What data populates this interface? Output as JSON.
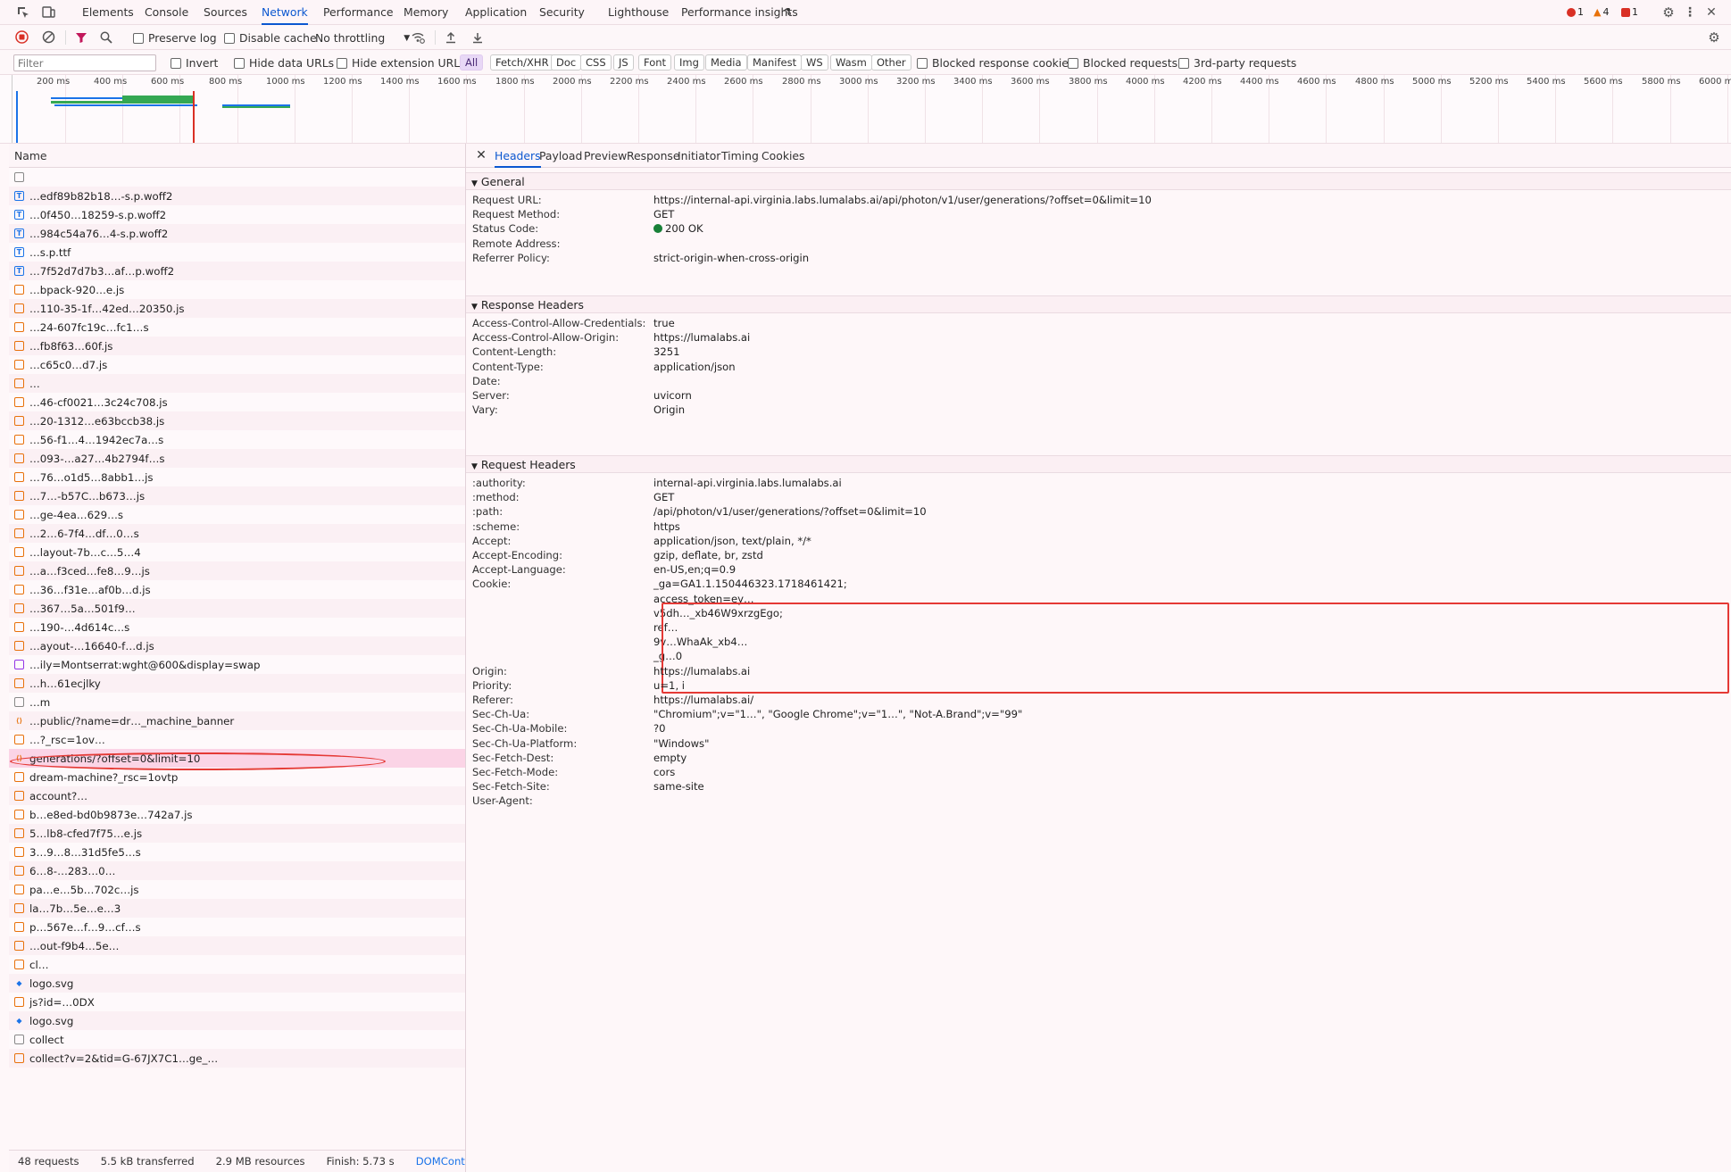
{
  "devtools_tabs": [
    "Elements",
    "Console",
    "Sources",
    "Network",
    "Performance",
    "Memory",
    "Application",
    "Security",
    "Lighthouse",
    "Performance insights"
  ],
  "active_tab": "Network",
  "badges": {
    "errors": "1",
    "warnings": "4",
    "issues": "1"
  },
  "toolbar": {
    "preserve_log": "Preserve log",
    "disable_cache": "Disable cache",
    "throttling": "No throttling"
  },
  "filterbar": {
    "filter_placeholder": "Filter",
    "invert": "Invert",
    "hide_data_urls": "Hide data URLs",
    "hide_extension_urls": "Hide extension URLs",
    "type_filters": [
      "All",
      "Fetch/XHR",
      "Doc",
      "CSS",
      "JS",
      "Font",
      "Img",
      "Media",
      "Manifest",
      "WS",
      "Wasm",
      "Other"
    ],
    "blocked_response_cookies": "Blocked response cookies",
    "blocked_requests": "Blocked requests",
    "third_party": "3rd-party requests"
  },
  "timeline_ticks": [
    "200 ms",
    "400 ms",
    "600 ms",
    "800 ms",
    "1000 ms",
    "1200 ms",
    "1400 ms",
    "1600 ms",
    "1800 ms",
    "2000 ms",
    "2200 ms",
    "2400 ms",
    "2600 ms",
    "2800 ms",
    "3000 ms",
    "3200 ms",
    "3400 ms",
    "3600 ms",
    "3800 ms",
    "4000 ms",
    "4200 ms",
    "4400 ms",
    "4600 ms",
    "4800 ms",
    "5000 ms",
    "5200 ms",
    "5400 ms",
    "5600 ms",
    "5800 ms",
    "6000 ms"
  ],
  "list_header": "Name",
  "requests": [
    {
      "type": "doc",
      "name": ""
    },
    {
      "type": "font",
      "name": "…edf89b82b18…-s.p.woff2"
    },
    {
      "type": "font",
      "name": "…0f450…18259-s.p.woff2"
    },
    {
      "type": "font",
      "name": "…984c54a76…4-s.p.woff2"
    },
    {
      "type": "font",
      "name": "…s.p.ttf"
    },
    {
      "type": "font",
      "name": "…7f52d7d7b3…af…p.woff2"
    },
    {
      "type": "script",
      "name": "…bpack-920…e.js"
    },
    {
      "type": "script",
      "name": "…110-35-1f…42ed…20350.js"
    },
    {
      "type": "script",
      "name": "…24-607fc19c…fc1…s"
    },
    {
      "type": "script",
      "name": "…fb8f63…60f.js"
    },
    {
      "type": "script",
      "name": "…c65c0…d7.js"
    },
    {
      "type": "script",
      "name": "…"
    },
    {
      "type": "script",
      "name": "…46-cf0021…3c24c708.js"
    },
    {
      "type": "script",
      "name": "…20-1312…e63bccb38.js"
    },
    {
      "type": "script",
      "name": "…56-f1…4…1942ec7a…s"
    },
    {
      "type": "script",
      "name": "…093-…a27…4b2794f…s"
    },
    {
      "type": "script",
      "name": "…76…o1d5…8abb1…js"
    },
    {
      "type": "script",
      "name": "…7…-b57C…b673…js"
    },
    {
      "type": "script",
      "name": "…ge-4ea…629…s"
    },
    {
      "type": "script",
      "name": "…2…6-7f4…df…0…s"
    },
    {
      "type": "script",
      "name": "…layout-7b…c…5…4"
    },
    {
      "type": "script",
      "name": "…a…f3ced…fe8…9…js"
    },
    {
      "type": "script",
      "name": "…36…f31e…af0b…d.js"
    },
    {
      "type": "script",
      "name": "…367…5a…501f9…"
    },
    {
      "type": "script",
      "name": "…190-…4d614c…s"
    },
    {
      "type": "script",
      "name": "…ayout-…16640-f…d.js"
    },
    {
      "type": "css",
      "name": "…ily=Montserrat:wght@600&display=swap"
    },
    {
      "type": "script",
      "name": "…h…61ecjlky"
    },
    {
      "type": "doc",
      "name": "…m"
    },
    {
      "type": "xhr",
      "name": "…public/?name=dr…_machine_banner"
    },
    {
      "type": "script",
      "name": "…?_rsc=1ov…"
    },
    {
      "type": "xhr",
      "name": "generations/?offset=0&limit=10",
      "selected": true
    },
    {
      "type": "script",
      "name": "dream-machine?_rsc=1ovtp"
    },
    {
      "type": "script",
      "name": "account?…"
    },
    {
      "type": "script",
      "name": "b…e8ed-bd0b9873e…742a7.js"
    },
    {
      "type": "script",
      "name": "5…lb8-cfed7f75…e.js"
    },
    {
      "type": "script",
      "name": "3…9…8…31d5fe5…s"
    },
    {
      "type": "script",
      "name": "6…8-…283…0…"
    },
    {
      "type": "script",
      "name": "pa…e…5b…702c…js"
    },
    {
      "type": "script",
      "name": "la…7b…5e…e…3"
    },
    {
      "type": "script",
      "name": "p…567e…f…9…cf…s"
    },
    {
      "type": "script",
      "name": "…out-f9b4…5e…"
    },
    {
      "type": "script",
      "name": "cl…"
    },
    {
      "type": "img",
      "name": "logo.svg"
    },
    {
      "type": "script",
      "name": "js?id=…0DX"
    },
    {
      "type": "img",
      "name": "logo.svg"
    },
    {
      "type": "doc",
      "name": "collect"
    },
    {
      "type": "script",
      "name": "collect?v=2&tid=G-67JX7C1…ge_…"
    }
  ],
  "statusbar": {
    "requests": "48 requests",
    "transferred": "5.5 kB transferred",
    "resources": "2.9 MB resources",
    "finish": "Finish: 5.73 s",
    "dcl": "DOMContentLoaded"
  },
  "detail_tabs": [
    "Headers",
    "Payload",
    "Preview",
    "Response",
    "Initiator",
    "Timing",
    "Cookies"
  ],
  "general": {
    "title": "General",
    "rows": [
      {
        "name": "Request URL:",
        "value": "https://internal-api.virginia.labs.lumalabs.ai/api/photon/v1/user/generations/?offset=0&limit=10"
      },
      {
        "name": "Request Method:",
        "value": "GET"
      },
      {
        "name": "Status Code:",
        "value": "200 OK"
      },
      {
        "name": "Remote Address:",
        "value": ""
      },
      {
        "name": "Referrer Policy:",
        "value": "strict-origin-when-cross-origin"
      }
    ]
  },
  "response_headers": {
    "title": "Response Headers",
    "rows": [
      {
        "name": "Access-Control-Allow-Credentials:",
        "value": "true"
      },
      {
        "name": "Access-Control-Allow-Origin:",
        "value": "https://lumalabs.ai"
      },
      {
        "name": "Content-Length:",
        "value": "3251"
      },
      {
        "name": "Content-Type:",
        "value": "application/json"
      },
      {
        "name": "Date:",
        "value": ""
      },
      {
        "name": "Server:",
        "value": "uvicorn"
      },
      {
        "name": "Vary:",
        "value": "Origin"
      }
    ]
  },
  "request_headers": {
    "title": "Request Headers",
    "rows": [
      {
        "name": ":authority:",
        "value": "internal-api.virginia.labs.lumalabs.ai"
      },
      {
        "name": ":method:",
        "value": "GET"
      },
      {
        "name": ":path:",
        "value": "/api/photon/v1/user/generations/?offset=0&limit=10"
      },
      {
        "name": ":scheme:",
        "value": "https"
      },
      {
        "name": "Accept:",
        "value": "application/json, text/plain, */*"
      },
      {
        "name": "Accept-Encoding:",
        "value": "gzip, deflate, br, zstd"
      },
      {
        "name": "Accept-Language:",
        "value": "en-US,en;q=0.9"
      }
    ],
    "cookie_name": "Cookie:",
    "cookie_lines": [
      "_ga=GA1.1.150446323.1718461421;",
      "access_token=ey…",
      "v5dh…_xb46W9xrzgEgo;",
      "ref…",
      "9v…WhaAk_xb4…",
      "_g…0"
    ],
    "rows_after": [
      {
        "name": "Origin:",
        "value": "https://lumalabs.ai"
      },
      {
        "name": "Priority:",
        "value": "u=1, i"
      },
      {
        "name": "Referer:",
        "value": "https://lumalabs.ai/"
      },
      {
        "name": "Sec-Ch-Ua:",
        "value": "\"Chromium\";v=\"1…\", \"Google Chrome\";v=\"1…\", \"Not-A.Brand\";v=\"99\""
      },
      {
        "name": "Sec-Ch-Ua-Mobile:",
        "value": "?0"
      },
      {
        "name": "Sec-Ch-Ua-Platform:",
        "value": "\"Windows\""
      },
      {
        "name": "Sec-Fetch-Dest:",
        "value": "empty"
      },
      {
        "name": "Sec-Fetch-Mode:",
        "value": "cors"
      },
      {
        "name": "Sec-Fetch-Site:",
        "value": "same-site"
      },
      {
        "name": "User-Agent:",
        "value": ""
      }
    ]
  },
  "colors": {
    "accent": "#0b57d0",
    "annotation": "#e53935",
    "selected_row": "#fbd4e6"
  }
}
